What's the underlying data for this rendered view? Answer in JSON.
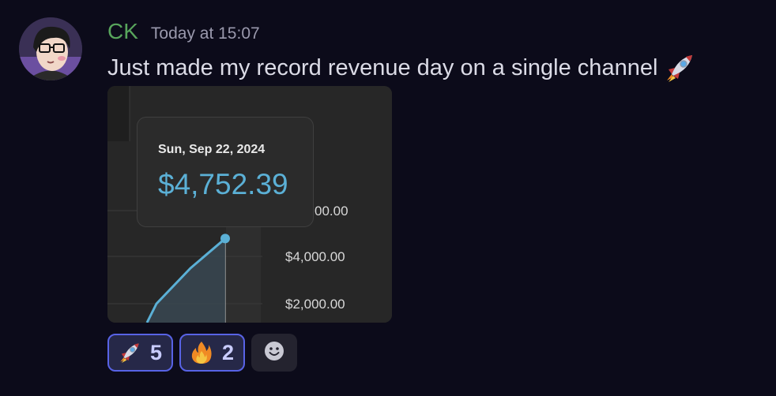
{
  "message": {
    "author": {
      "name": "CK",
      "name_color": "#58a55c"
    },
    "timestamp": "Today at 15:07",
    "text": "Just made my record revenue day on a single channel",
    "text_emoji": "rocket-icon"
  },
  "attachment": {
    "tooltip": {
      "date": "Sun, Sep 22, 2024",
      "value": "$4,752.39"
    },
    "y_tick_labels": [
      "00.00",
      "$4,000.00",
      "$2,000.00"
    ],
    "line_color": "#5bb0d6",
    "chart_data": {
      "type": "line",
      "series": [
        {
          "values": [
            2000,
            3500,
            4752.39
          ]
        }
      ]
    }
  },
  "reactions": [
    {
      "emoji": "rocket-icon",
      "count": "5"
    },
    {
      "emoji": "fire-icon",
      "count": "2"
    }
  ],
  "add_reaction_icon": "smiley-icon",
  "colors": {
    "background": "#0c0b1a",
    "reaction_border": "#5863e6",
    "reaction_bg": "#262848"
  }
}
